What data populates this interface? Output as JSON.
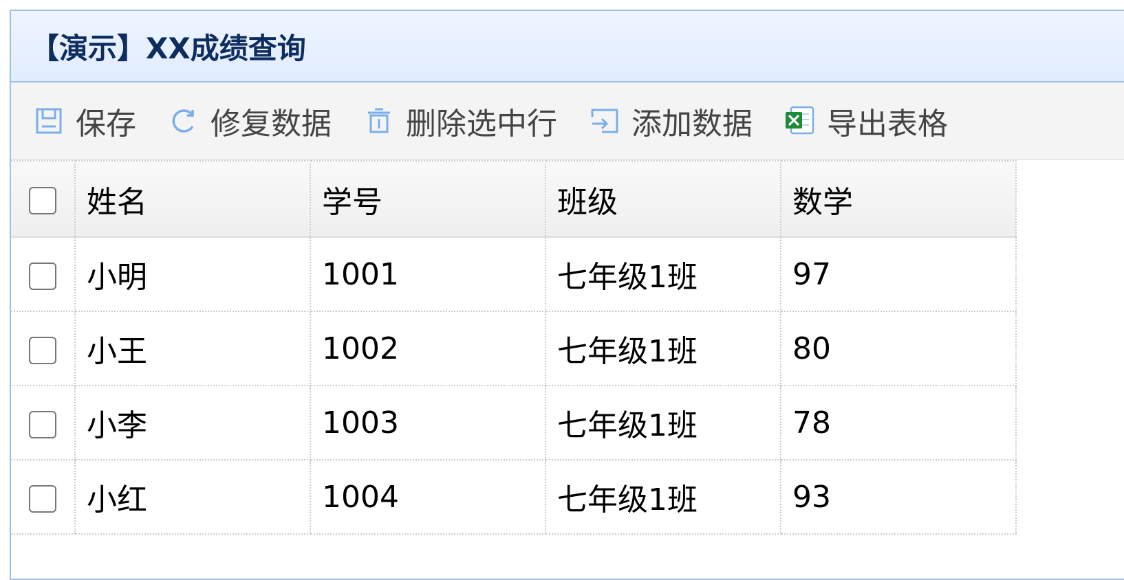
{
  "panel": {
    "title": "【演示】XX成绩查询"
  },
  "toolbar": {
    "buttons": [
      {
        "label": "保存",
        "icon": "save-icon"
      },
      {
        "label": "修复数据",
        "icon": "reload-icon"
      },
      {
        "label": "删除选中行",
        "icon": "trash-icon"
      },
      {
        "label": "添加数据",
        "icon": "add-data-icon"
      },
      {
        "label": "导出表格",
        "icon": "excel-icon"
      }
    ]
  },
  "grid": {
    "columns": [
      "姓名",
      "学号",
      "班级",
      "数学"
    ],
    "rows": [
      {
        "name": "小明",
        "id": "1001",
        "class": "七年级1班",
        "math": "97"
      },
      {
        "name": "小王",
        "id": "1002",
        "class": "七年级1班",
        "math": "80"
      },
      {
        "name": "小李",
        "id": "1003",
        "class": "七年级1班",
        "math": "78"
      },
      {
        "name": "小红",
        "id": "1004",
        "class": "七年级1班",
        "math": "93"
      }
    ]
  },
  "colors": {
    "header_border": "#9cbfe8",
    "title_color": "#0e2d5f",
    "icon_blue": "#7aaee8",
    "excel_green": "#1f8a3a"
  }
}
